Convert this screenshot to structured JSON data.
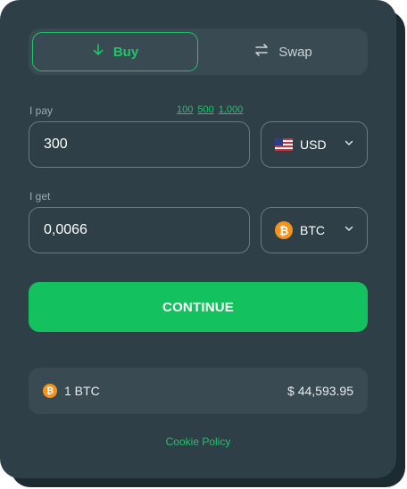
{
  "tabs": [
    {
      "label": "Buy",
      "icon": "arrow-down-icon",
      "active": true
    },
    {
      "label": "Swap",
      "icon": "swap-icon",
      "active": false
    }
  ],
  "pay": {
    "label": "I pay",
    "presets": [
      "100",
      "500",
      "1,000"
    ],
    "amount": "300",
    "currency": "USD",
    "currency_icon": "us-flag-icon"
  },
  "get": {
    "label": "I get",
    "amount": "0,0066",
    "currency": "BTC",
    "currency_icon": "bitcoin-icon"
  },
  "continue_label": "CONTINUE",
  "rate": {
    "left": "1 BTC",
    "right": "$ 44,593.95"
  },
  "cookie_label": "Cookie Policy",
  "colors": {
    "accent": "#13c25f",
    "card": "#2f3f47",
    "bitcoin": "#f7931a"
  }
}
